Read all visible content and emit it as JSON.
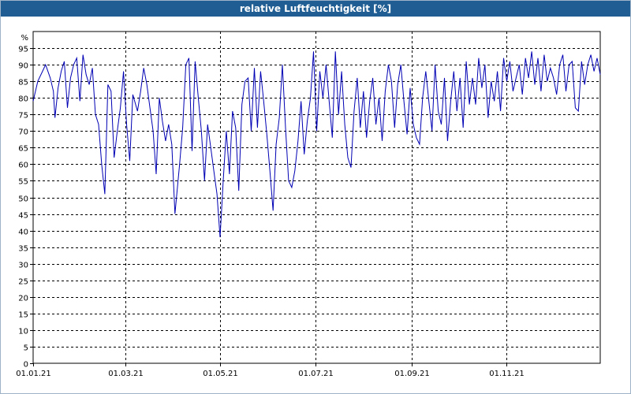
{
  "chart_data": {
    "type": "line",
    "title": "relative Luftfeuchtigkeit [%]",
    "ylabel": "%",
    "xlabel": "",
    "ylim": [
      0,
      100
    ],
    "y_ticks": [
      0,
      5,
      10,
      15,
      20,
      25,
      30,
      35,
      40,
      45,
      50,
      55,
      60,
      65,
      70,
      75,
      80,
      85,
      90,
      95
    ],
    "x_ticks": [
      {
        "date": "2021-01-01",
        "label": "01.01.21"
      },
      {
        "date": "2021-03-01",
        "label": "01.03.21"
      },
      {
        "date": "2021-05-01",
        "label": "01.05.21"
      },
      {
        "date": "2021-07-01",
        "label": "01.07.21"
      },
      {
        "date": "2021-09-01",
        "label": "01.09.21"
      },
      {
        "date": "2021-11-01",
        "label": "01.11.21"
      }
    ],
    "xlim": [
      "2021-01-01",
      "2021-12-31"
    ],
    "grid": true,
    "series_color": "#0000b4",
    "series": [
      {
        "name": "",
        "points": [
          [
            "2021-01-01",
            79
          ],
          [
            "2021-01-04",
            85
          ],
          [
            "2021-01-07",
            88
          ],
          [
            "2021-01-09",
            90
          ],
          [
            "2021-01-12",
            86
          ],
          [
            "2021-01-14",
            82
          ],
          [
            "2021-01-15",
            74
          ],
          [
            "2021-01-17",
            83
          ],
          [
            "2021-01-19",
            88
          ],
          [
            "2021-01-21",
            91
          ],
          [
            "2021-01-23",
            77
          ],
          [
            "2021-01-25",
            86
          ],
          [
            "2021-01-27",
            90
          ],
          [
            "2021-01-29",
            92
          ],
          [
            "2021-01-31",
            79
          ],
          [
            "2021-02-02",
            93
          ],
          [
            "2021-02-04",
            87
          ],
          [
            "2021-02-06",
            84
          ],
          [
            "2021-02-08",
            89
          ],
          [
            "2021-02-10",
            75
          ],
          [
            "2021-02-12",
            72
          ],
          [
            "2021-02-14",
            60
          ],
          [
            "2021-02-16",
            51
          ],
          [
            "2021-02-18",
            84
          ],
          [
            "2021-02-20",
            82
          ],
          [
            "2021-02-22",
            62
          ],
          [
            "2021-02-24",
            70
          ],
          [
            "2021-02-26",
            77
          ],
          [
            "2021-02-28",
            88
          ],
          [
            "2021-03-02",
            72
          ],
          [
            "2021-03-04",
            61
          ],
          [
            "2021-03-06",
            81
          ],
          [
            "2021-03-09",
            76
          ],
          [
            "2021-03-11",
            82
          ],
          [
            "2021-03-13",
            89
          ],
          [
            "2021-03-15",
            84
          ],
          [
            "2021-03-17",
            77
          ],
          [
            "2021-03-19",
            70
          ],
          [
            "2021-03-21",
            57
          ],
          [
            "2021-03-23",
            80
          ],
          [
            "2021-03-25",
            73
          ],
          [
            "2021-03-27",
            67
          ],
          [
            "2021-03-29",
            72
          ],
          [
            "2021-03-31",
            66
          ],
          [
            "2021-04-02",
            45
          ],
          [
            "2021-04-05",
            60
          ],
          [
            "2021-04-07",
            71
          ],
          [
            "2021-04-09",
            90
          ],
          [
            "2021-04-11",
            92
          ],
          [
            "2021-04-13",
            64
          ],
          [
            "2021-04-15",
            91
          ],
          [
            "2021-04-17",
            80
          ],
          [
            "2021-04-19",
            70
          ],
          [
            "2021-04-21",
            55
          ],
          [
            "2021-04-23",
            72
          ],
          [
            "2021-04-25",
            65
          ],
          [
            "2021-04-27",
            58
          ],
          [
            "2021-04-29",
            51
          ],
          [
            "2021-05-01",
            38
          ],
          [
            "2021-05-03",
            55
          ],
          [
            "2021-05-05",
            70
          ],
          [
            "2021-05-07",
            57
          ],
          [
            "2021-05-09",
            76
          ],
          [
            "2021-05-11",
            71
          ],
          [
            "2021-05-13",
            52
          ],
          [
            "2021-05-15",
            78
          ],
          [
            "2021-05-17",
            85
          ],
          [
            "2021-05-19",
            86
          ],
          [
            "2021-05-21",
            70
          ],
          [
            "2021-05-23",
            89
          ],
          [
            "2021-05-25",
            71
          ],
          [
            "2021-05-27",
            88
          ],
          [
            "2021-05-29",
            79
          ],
          [
            "2021-05-31",
            69
          ],
          [
            "2021-06-02",
            58
          ],
          [
            "2021-06-04",
            46
          ],
          [
            "2021-06-06",
            66
          ],
          [
            "2021-06-08",
            74
          ],
          [
            "2021-06-10",
            90
          ],
          [
            "2021-06-12",
            71
          ],
          [
            "2021-06-14",
            55
          ],
          [
            "2021-06-16",
            53
          ],
          [
            "2021-06-18",
            58
          ],
          [
            "2021-06-20",
            67
          ],
          [
            "2021-06-22",
            79
          ],
          [
            "2021-06-24",
            63
          ],
          [
            "2021-06-26",
            73
          ],
          [
            "2021-06-28",
            80
          ],
          [
            "2021-06-30",
            94
          ],
          [
            "2021-07-02",
            70
          ],
          [
            "2021-07-04",
            88
          ],
          [
            "2021-07-06",
            80
          ],
          [
            "2021-07-08",
            90
          ],
          [
            "2021-07-10",
            79
          ],
          [
            "2021-07-12",
            68
          ],
          [
            "2021-07-14",
            94
          ],
          [
            "2021-07-16",
            75
          ],
          [
            "2021-07-18",
            88
          ],
          [
            "2021-07-20",
            72
          ],
          [
            "2021-07-22",
            62
          ],
          [
            "2021-07-24",
            59
          ],
          [
            "2021-07-26",
            76
          ],
          [
            "2021-07-28",
            86
          ],
          [
            "2021-07-30",
            71
          ],
          [
            "2021-08-01",
            82
          ],
          [
            "2021-08-03",
            68
          ],
          [
            "2021-08-05",
            79
          ],
          [
            "2021-08-07",
            86
          ],
          [
            "2021-08-09",
            72
          ],
          [
            "2021-08-11",
            80
          ],
          [
            "2021-08-13",
            67
          ],
          [
            "2021-08-15",
            82
          ],
          [
            "2021-08-17",
            90
          ],
          [
            "2021-08-19",
            85
          ],
          [
            "2021-08-21",
            71
          ],
          [
            "2021-08-23",
            84
          ],
          [
            "2021-08-25",
            90
          ],
          [
            "2021-08-27",
            79
          ],
          [
            "2021-08-29",
            69
          ],
          [
            "2021-08-31",
            83
          ],
          [
            "2021-09-02",
            72
          ],
          [
            "2021-09-04",
            68
          ],
          [
            "2021-09-06",
            66
          ],
          [
            "2021-09-08",
            80
          ],
          [
            "2021-09-10",
            88
          ],
          [
            "2021-09-12",
            79
          ],
          [
            "2021-09-14",
            70
          ],
          [
            "2021-09-16",
            90
          ],
          [
            "2021-09-18",
            76
          ],
          [
            "2021-09-20",
            72
          ],
          [
            "2021-09-22",
            86
          ],
          [
            "2021-09-24",
            67
          ],
          [
            "2021-09-26",
            79
          ],
          [
            "2021-09-28",
            88
          ],
          [
            "2021-09-30",
            76
          ],
          [
            "2021-10-02",
            86
          ],
          [
            "2021-10-04",
            71
          ],
          [
            "2021-10-06",
            91
          ],
          [
            "2021-10-08",
            78
          ],
          [
            "2021-10-10",
            86
          ],
          [
            "2021-10-12",
            78
          ],
          [
            "2021-10-14",
            92
          ],
          [
            "2021-10-16",
            83
          ],
          [
            "2021-10-18",
            90
          ],
          [
            "2021-10-20",
            74
          ],
          [
            "2021-10-22",
            85
          ],
          [
            "2021-10-24",
            79
          ],
          [
            "2021-10-26",
            88
          ],
          [
            "2021-10-28",
            76
          ],
          [
            "2021-10-30",
            92
          ],
          [
            "2021-11-01",
            85
          ],
          [
            "2021-11-03",
            91
          ],
          [
            "2021-11-05",
            82
          ],
          [
            "2021-11-07",
            86
          ],
          [
            "2021-11-09",
            90
          ],
          [
            "2021-11-11",
            81
          ],
          [
            "2021-11-13",
            92
          ],
          [
            "2021-11-15",
            86
          ],
          [
            "2021-11-17",
            94
          ],
          [
            "2021-11-19",
            84
          ],
          [
            "2021-11-21",
            92
          ],
          [
            "2021-11-23",
            82
          ],
          [
            "2021-11-25",
            93
          ],
          [
            "2021-11-27",
            85
          ],
          [
            "2021-11-29",
            89
          ],
          [
            "2021-12-01",
            86
          ],
          [
            "2021-12-03",
            81
          ],
          [
            "2021-12-05",
            90
          ],
          [
            "2021-12-07",
            93
          ],
          [
            "2021-12-09",
            82
          ],
          [
            "2021-12-11",
            90
          ],
          [
            "2021-12-13",
            91
          ],
          [
            "2021-12-15",
            77
          ],
          [
            "2021-12-17",
            76
          ],
          [
            "2021-12-19",
            91
          ],
          [
            "2021-12-21",
            84
          ],
          [
            "2021-12-23",
            90
          ],
          [
            "2021-12-25",
            93
          ],
          [
            "2021-12-27",
            88
          ],
          [
            "2021-12-29",
            92
          ],
          [
            "2021-12-31",
            87
          ]
        ]
      }
    ]
  }
}
